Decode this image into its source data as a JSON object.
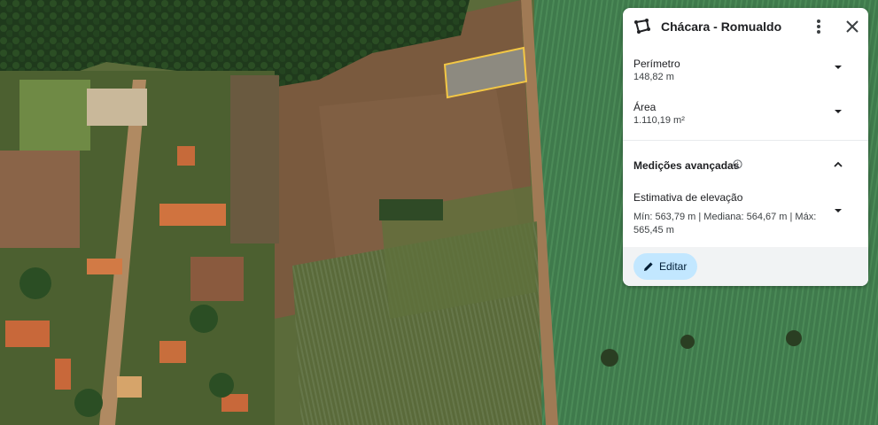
{
  "map": {
    "selection_color": "#f3c745",
    "field_colors": {
      "crop": "#3f7a4c",
      "soil": "#7a5a3e",
      "forest": "#1f3a1c"
    }
  },
  "panel": {
    "title": "Chácara - Romualdo",
    "title_icon": "polygon-area-icon",
    "perimeter": {
      "label": "Perímetro",
      "value": "148,82 m"
    },
    "area": {
      "label": "Área",
      "value": "1.110,19 m²"
    },
    "advanced": {
      "label": "Medições avançadas"
    },
    "elevation": {
      "label": "Estimativa de elevação",
      "value": "Mín: 563,79 m | Mediana: 564,67 m | Máx: 565,45 m"
    },
    "edit_label": "Editar",
    "accent": "#c2e7ff"
  }
}
